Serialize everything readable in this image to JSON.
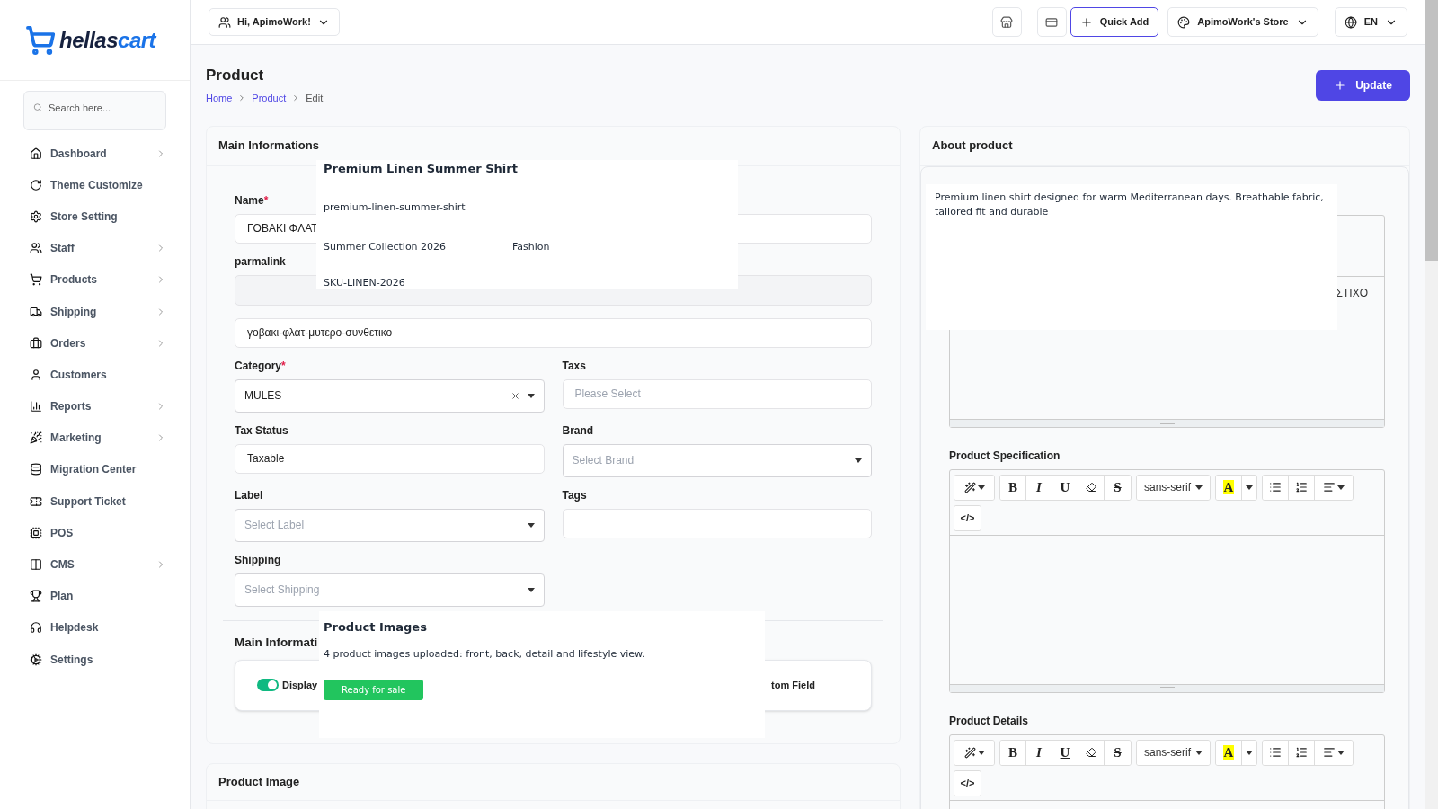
{
  "logo": {
    "part1": "hellas",
    "part2": "cart"
  },
  "sidebar": {
    "search_placeholder": "Search here...",
    "items": [
      {
        "label": "Dashboard",
        "expandable": true
      },
      {
        "label": "Theme Customize",
        "expandable": false
      },
      {
        "label": "Store Setting",
        "expandable": false
      },
      {
        "label": "Staff",
        "expandable": true
      },
      {
        "label": "Products",
        "expandable": true
      },
      {
        "label": "Shipping",
        "expandable": true
      },
      {
        "label": "Orders",
        "expandable": true
      },
      {
        "label": "Customers",
        "expandable": false
      },
      {
        "label": "Reports",
        "expandable": true
      },
      {
        "label": "Marketing",
        "expandable": true
      },
      {
        "label": "Migration Center",
        "expandable": false
      },
      {
        "label": "Support Ticket",
        "expandable": false
      },
      {
        "label": "POS",
        "expandable": false
      },
      {
        "label": "CMS",
        "expandable": true
      },
      {
        "label": "Plan",
        "expandable": false
      },
      {
        "label": "Helpdesk",
        "expandable": false
      },
      {
        "label": "Settings",
        "expandable": false
      }
    ]
  },
  "topbar": {
    "greeting": "Hi, ApimoWork!",
    "quick_add": "Quick Add",
    "store": "ApimoWork's Store",
    "language": "EN"
  },
  "page": {
    "title": "Product",
    "breadcrumbs": [
      {
        "label": "Home",
        "link": true
      },
      {
        "label": "Product",
        "link": true
      },
      {
        "label": "Edit",
        "link": false
      }
    ],
    "update_button": "Update"
  },
  "main_card": {
    "title": "Main Informations",
    "name": {
      "label": "Name",
      "required_mark": "*",
      "value": "ΓΟΒΑΚΙ ΦΛΑΤ"
    },
    "permalink": {
      "label": "parmalink"
    },
    "slug": {
      "value": "γοβακι-φλατ-μυτερο-συνθετικο"
    },
    "grid_fields": [
      {
        "kind": "select",
        "label": "Category",
        "required_mark": "*",
        "value": "MULES",
        "clearable": true
      },
      {
        "kind": "input",
        "label": "Taxs",
        "placeholder": "Please Select"
      },
      {
        "kind": "input",
        "label": "Tax Status",
        "value": "Taxable"
      },
      {
        "kind": "select",
        "label": "Brand",
        "placeholder": "Select Brand",
        "clearable": false
      },
      {
        "kind": "select",
        "label": "Label",
        "placeholder": "Select Label",
        "clearable": false
      },
      {
        "kind": "input",
        "label": "Tags"
      },
      {
        "kind": "select",
        "label": "Shipping",
        "placeholder": "Select Shipping",
        "clearable": false
      }
    ],
    "section_title": "Main Informati",
    "toggle": {
      "label": "Display",
      "on": true
    },
    "right_text": "tom Field"
  },
  "image_card": {
    "title": "Product Image"
  },
  "about_card": {
    "title": "About product",
    "about_text": "ΣΤΙΧΟ",
    "editors": [
      {
        "label": "Product Specification",
        "toolbar_rows": [
          [
            [
              {
                "kind": "wand"
              }
            ],
            [
              {
                "kind": "bold",
                "label": "B"
              },
              {
                "kind": "italic",
                "label": "I"
              },
              {
                "kind": "underline",
                "label": "U"
              },
              {
                "kind": "eraser"
              },
              {
                "kind": "strike",
                "label": "S"
              }
            ],
            [
              {
                "kind": "font",
                "label": "sans-serif"
              }
            ],
            [
              {
                "kind": "color",
                "label": "A"
              },
              {
                "kind": "caret"
              }
            ],
            [
              {
                "kind": "ul"
              },
              {
                "kind": "ol"
              },
              {
                "kind": "align"
              }
            ]
          ],
          [
            [
              {
                "kind": "code",
                "label": "</>"
              }
            ]
          ]
        ]
      },
      {
        "label": "Product Details",
        "toolbar_rows": [
          [
            [
              {
                "kind": "wand"
              }
            ],
            [
              {
                "kind": "bold",
                "label": "B"
              },
              {
                "kind": "italic",
                "label": "I"
              },
              {
                "kind": "underline",
                "label": "U"
              },
              {
                "kind": "eraser"
              },
              {
                "kind": "strike",
                "label": "S"
              }
            ],
            [
              {
                "kind": "font",
                "label": "sans-serif"
              }
            ],
            [
              {
                "kind": "color",
                "label": "A"
              },
              {
                "kind": "caret"
              }
            ],
            [
              {
                "kind": "ul"
              },
              {
                "kind": "ol"
              },
              {
                "kind": "align"
              }
            ]
          ],
          [
            [
              {
                "kind": "code",
                "label": "</>"
              }
            ]
          ]
        ]
      }
    ]
  },
  "overlays": [
    {
      "kind": "product",
      "title": "Premium Linen Summer Shirt",
      "slug": "premium-linen-summer-shirt",
      "collection": "Summer Collection 2026",
      "category": "Fashion",
      "sku": "SKU-LINEN-2026"
    },
    {
      "kind": "images",
      "title": "Product Images",
      "text": "4 product images uploaded: front, back, detail and lifestyle view.",
      "badge": "Ready for sale"
    },
    {
      "kind": "description",
      "text": "Premium linen shirt designed for warm Mediterranean days. Breathable fabric, tailored fit and durable"
    }
  ]
}
